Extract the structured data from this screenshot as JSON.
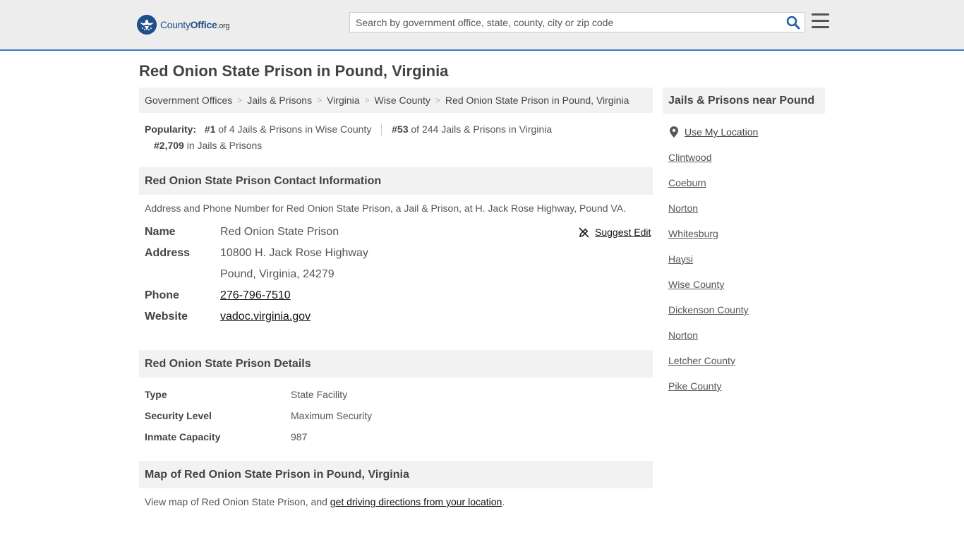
{
  "header": {
    "logo_county": "County",
    "logo_office": "Office",
    "logo_org": ".org",
    "search_placeholder": "Search by government office, state, county, city or zip code",
    "search_icon": "search-icon",
    "menu_icon": "hamburger-menu-icon"
  },
  "page_title": "Red Onion State Prison in Pound, Virginia",
  "breadcrumb": [
    "Government Offices",
    "Jails & Prisons",
    "Virginia",
    "Wise County",
    "Red Onion State Prison in Pound, Virginia"
  ],
  "popularity": {
    "label": "Popularity:",
    "rank1": "#1",
    "rank1_text": "of 4 Jails & Prisons in Wise County",
    "rank2": "#53",
    "rank2_text": "of 244 Jails & Prisons in Virginia",
    "rank3": "#2,709",
    "rank3_text": "in Jails & Prisons"
  },
  "contact": {
    "heading": "Red Onion State Prison Contact Information",
    "description": "Address and Phone Number for Red Onion State Prison, a Jail & Prison, at H. Jack Rose Highway, Pound VA.",
    "suggest_edit": "Suggest Edit",
    "name_label": "Name",
    "name_value": "Red Onion State Prison",
    "address_label": "Address",
    "address_line1": "10800 H. Jack Rose Highway",
    "address_line2": "Pound, Virginia, 24279",
    "phone_label": "Phone",
    "phone_value": "276-796-7510",
    "website_label": "Website",
    "website_value": "vadoc.virginia.gov"
  },
  "details": {
    "heading": "Red Onion State Prison Details",
    "rows": [
      {
        "label": "Type",
        "value": "State Facility"
      },
      {
        "label": "Security Level",
        "value": "Maximum Security"
      },
      {
        "label": "Inmate Capacity",
        "value": "987"
      }
    ]
  },
  "map": {
    "heading": "Map of Red Onion State Prison in Pound, Virginia",
    "desc_prefix": "View map of Red Onion State Prison, and ",
    "desc_link": "get driving directions from your location",
    "desc_suffix": "."
  },
  "sidebar": {
    "heading": "Jails & Prisons near Pound",
    "use_location": "Use My Location",
    "items": [
      "Clintwood",
      "Coeburn",
      "Norton",
      "Whitesburg",
      "Haysi",
      "Wise County",
      "Dickenson County",
      "Norton",
      "Letcher County",
      "Pike County"
    ]
  },
  "colors": {
    "header_bg": "#ededed",
    "header_border": "#3b7bbf",
    "brand_blue": "#1e4f8a",
    "section_bg": "#f2f2f2"
  }
}
